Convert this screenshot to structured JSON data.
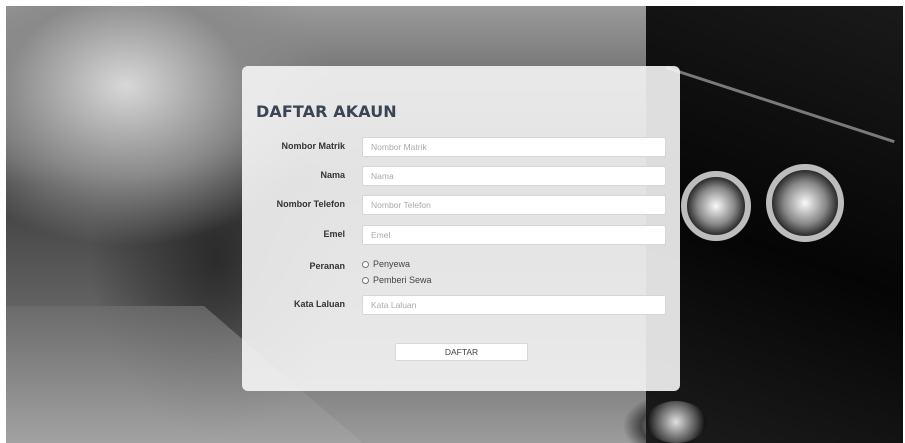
{
  "form": {
    "title": "DAFTAR AKAUN",
    "fields": {
      "matric": {
        "label": "Nombor Matrik",
        "placeholder": "Nombor Matrik",
        "value": ""
      },
      "name": {
        "label": "Nama",
        "placeholder": "Nama",
        "value": ""
      },
      "phone": {
        "label": "Nombor Telefon",
        "placeholder": "Nombor Telefon",
        "value": ""
      },
      "email": {
        "label": "Emel",
        "placeholder": "Emel",
        "value": ""
      },
      "password": {
        "label": "Kata Laluan",
        "placeholder": "Kata Laluan",
        "value": ""
      }
    },
    "role": {
      "label": "Peranan",
      "options": [
        "Penyewa",
        "Pemberi Sewa"
      ],
      "selected": null
    },
    "submit_label": "DAFTAR"
  },
  "colors": {
    "card_bg": "#f5f5f5",
    "title": "#3a4452"
  }
}
